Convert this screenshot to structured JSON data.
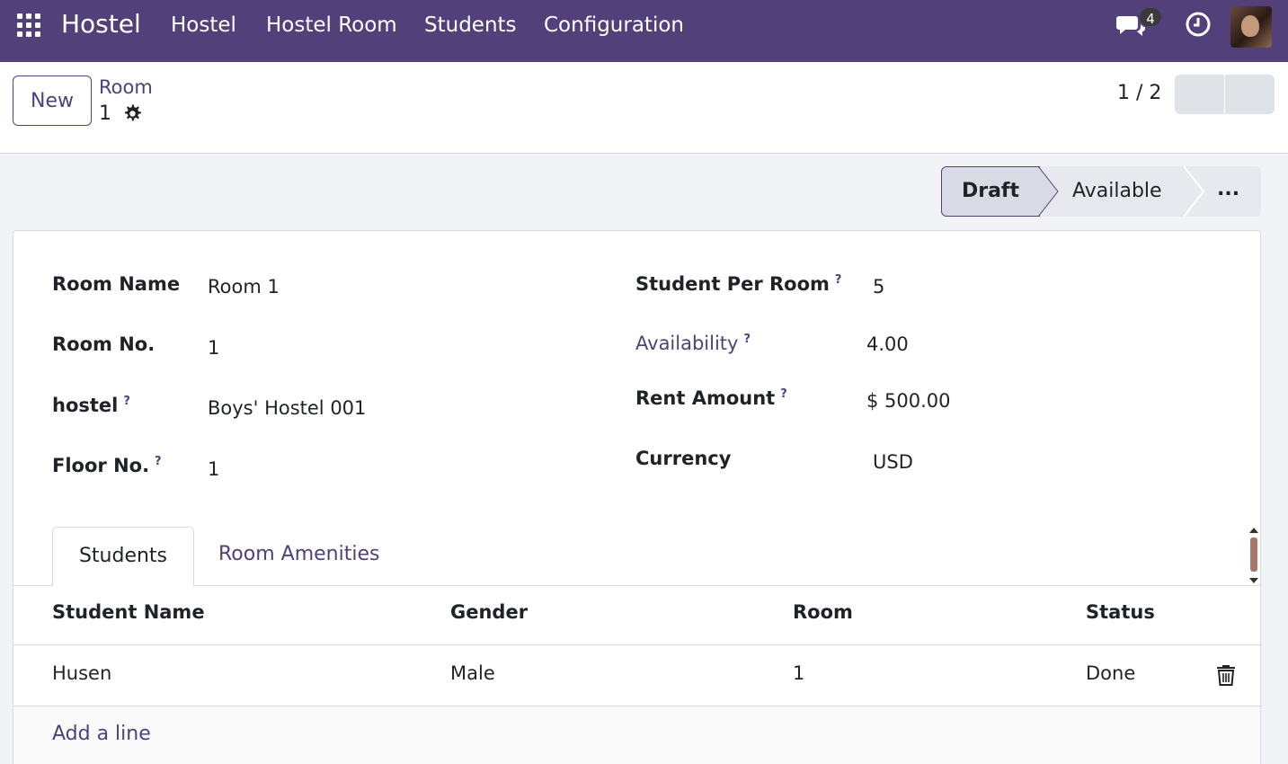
{
  "navbar": {
    "brand": "Hostel",
    "menu": [
      "Hostel",
      "Hostel Room",
      "Students",
      "Configuration"
    ],
    "chat_count": "4",
    "icons": {
      "apps": "apps-grid-icon",
      "chat": "chat-icon",
      "activity": "clock-icon"
    }
  },
  "control_panel": {
    "new_label": "New",
    "breadcrumb": "Room",
    "record_name": "1",
    "pager": "1 / 2"
  },
  "statusbar": {
    "stages": [
      "Draft",
      "Available",
      "..."
    ],
    "active": "Draft"
  },
  "form": {
    "left": [
      {
        "label": "Room Name",
        "help": "",
        "value": "Room 1"
      },
      {
        "label": "Room No.",
        "help": "",
        "value": "1"
      },
      {
        "label": "hostel",
        "help": "?",
        "value": "Boys' Hostel 001"
      },
      {
        "label": "Floor No.",
        "help": "?",
        "value": "1"
      }
    ],
    "right": [
      {
        "label": "Student Per Room",
        "help": "?",
        "value": "5"
      },
      {
        "label": "Availability",
        "help": "?",
        "value": "4.00"
      },
      {
        "label": "Rent Amount",
        "help": "?",
        "value": "$ 500.00"
      },
      {
        "label": "Currency",
        "help": "",
        "value": "USD"
      }
    ]
  },
  "tabs": [
    "Students",
    "Room Amenities"
  ],
  "table": {
    "columns": [
      "Student Name",
      "Gender",
      "Room",
      "Status"
    ],
    "rows": [
      {
        "name": "Husen",
        "gender": "Male",
        "room": "1",
        "status": "Done"
      }
    ],
    "add_line": "Add a line"
  },
  "colors": {
    "brand": "#51407a",
    "background": "#f1f3f6"
  }
}
